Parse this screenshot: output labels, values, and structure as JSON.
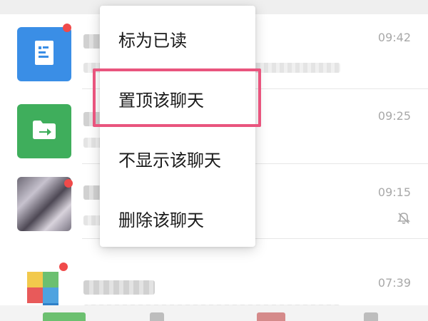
{
  "chat_list": {
    "rows": [
      {
        "time": "09:42",
        "avatar_icon": "document-icon",
        "avatar_color": "#3a8ee6",
        "unread": true
      },
      {
        "time": "09:25",
        "avatar_icon": "folder-transfer-icon",
        "avatar_color": "#3fae5c",
        "unread": false
      },
      {
        "time": "09:15",
        "avatar_icon": "photo-avatar",
        "unread": true,
        "muted": true,
        "mute_icon": "bell-off-icon"
      },
      {
        "time": "07:39",
        "avatar_icon": "group-avatar",
        "unread": true
      }
    ]
  },
  "context_menu": {
    "items": [
      {
        "label": "标为已读"
      },
      {
        "label": "置顶该聊天",
        "highlighted": true
      },
      {
        "label": "不显示该聊天"
      },
      {
        "label": "删除该聊天"
      }
    ],
    "highlight_color": "#e9557e"
  },
  "colors": {
    "unread_dot": "#f04a4a",
    "time_text": "#a8a8a8"
  }
}
